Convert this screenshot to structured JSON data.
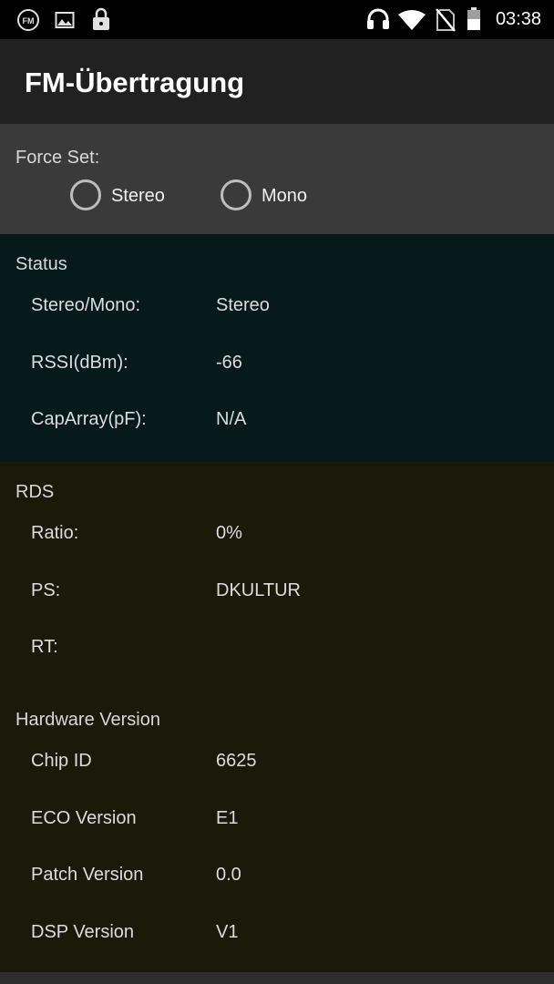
{
  "status_bar": {
    "left_icons": [
      "fm-radio-icon",
      "image-icon",
      "lock-icon"
    ],
    "right_icons": [
      "headset-icon",
      "wifi-icon",
      "no-sim-icon",
      "battery-icon"
    ],
    "fm_badge": "FM",
    "time": "03:38"
  },
  "app_bar": {
    "title": "FM-Übertragung"
  },
  "force_set": {
    "label": "Force Set:",
    "options": [
      {
        "label": "Stereo",
        "checked": false
      },
      {
        "label": "Mono",
        "checked": false
      }
    ]
  },
  "status": {
    "title": "Status",
    "rows": [
      {
        "key": "Stereo/Mono:",
        "value": "Stereo"
      },
      {
        "key": "RSSI(dBm):",
        "value": "-66"
      },
      {
        "key": "CapArray(pF):",
        "value": "N/A"
      }
    ]
  },
  "rds": {
    "title": "RDS",
    "rows": [
      {
        "key": "Ratio:",
        "value": "0%"
      },
      {
        "key": "PS:",
        "value": "DKULTUR"
      },
      {
        "key": "RT:",
        "value": ""
      }
    ]
  },
  "hardware": {
    "title": "Hardware Version",
    "rows": [
      {
        "key": "Chip ID",
        "value": "6625"
      },
      {
        "key": "ECO Version",
        "value": "E1"
      },
      {
        "key": "Patch Version",
        "value": "0.0"
      },
      {
        "key": "DSP Version",
        "value": "V1"
      }
    ]
  },
  "colors": {
    "statusbar_bg": "#000000",
    "appbar_bg": "#212121",
    "force_section_bg": "#3a3a3a",
    "status_section_bg": "#061a1c",
    "rds_section_bg": "#1b1a0a"
  }
}
